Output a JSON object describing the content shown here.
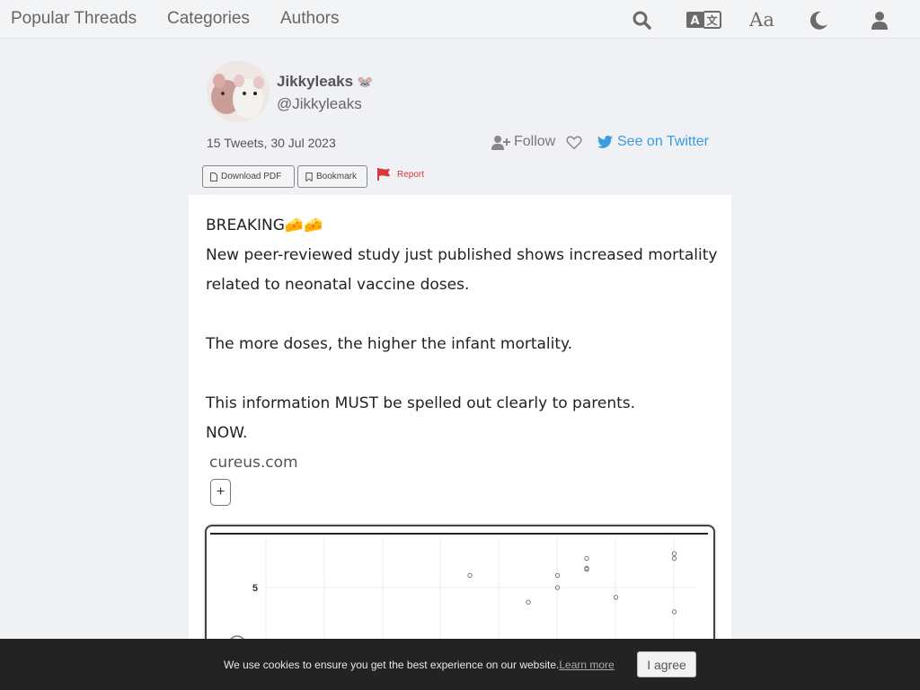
{
  "nav": {
    "links": [
      "Popular Threads",
      "Categories",
      "Authors"
    ],
    "icons": [
      "search-icon",
      "translate-icon",
      "font-size-icon",
      "dark-mode-icon",
      "user-icon"
    ],
    "font_icon_text": "Aa"
  },
  "author": {
    "name": "Jikkyleaks",
    "name_emoji": "🐭",
    "handle": "@Jikkyleaks",
    "meta": "15 Tweets, 30 Jul 2023"
  },
  "actions": {
    "follow": "Follow",
    "twitter": "See on Twitter",
    "download_pdf": "Download PDF",
    "bookmark": "Bookmark",
    "report": "Report"
  },
  "tweet": {
    "line1": "BREAKING🧀🧀",
    "line2": "New peer-reviewed study just published shows increased mortality",
    "line3": "related to neonatal vaccine doses.",
    "line4": "The more doses, the higher the infant mortality.",
    "line5": "This information MUST be spelled out clearly to parents.",
    "line6": "NOW.",
    "link_domain": "cureus.com",
    "expand_symbol": "+"
  },
  "chart_data": {
    "type": "scatter",
    "yticks": [
      "5"
    ],
    "points": [
      {
        "x": 0.49,
        "y": 5.5
      },
      {
        "x": 0.59,
        "y": 4.4
      },
      {
        "x": 0.64,
        "y": 5.0
      },
      {
        "x": 0.64,
        "y": 5.5
      },
      {
        "x": 0.69,
        "y": 5.75
      },
      {
        "x": 0.69,
        "y": 5.8
      },
      {
        "x": 0.69,
        "y": 6.2
      },
      {
        "x": 0.74,
        "y": 4.6
      },
      {
        "x": 0.84,
        "y": 6.2
      },
      {
        "x": 0.84,
        "y": 6.4
      },
      {
        "x": 0.84,
        "y": 4.0
      }
    ]
  },
  "cookie": {
    "text": "We use cookies to ensure you get the best experience on our website.",
    "learn_more": "Learn more",
    "agree": "I agree"
  },
  "colors": {
    "twitter": "#3a9be0",
    "report": "#d9363e",
    "cookie_bg": "#232323"
  }
}
